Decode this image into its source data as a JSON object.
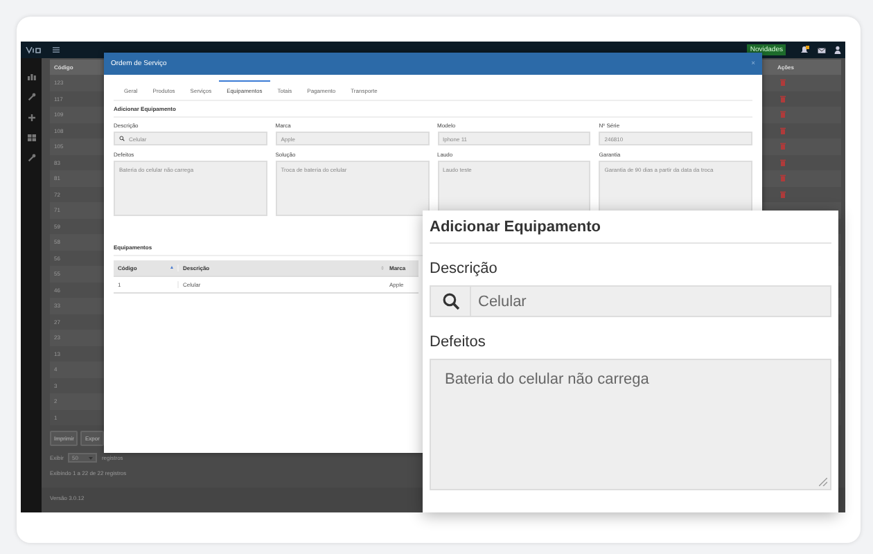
{
  "app": {
    "topbar": {
      "badge": "Novidades"
    },
    "list": {
      "columns": [
        "Código",
        "Ações"
      ],
      "rows": [
        {
          "code": "123",
          "kind": "deletable"
        },
        {
          "code": "117",
          "kind": "deletable"
        },
        {
          "code": "109",
          "kind": "deletable"
        },
        {
          "code": "108",
          "kind": "deletable"
        },
        {
          "code": "105",
          "kind": "deletable"
        },
        {
          "code": "83",
          "kind": "deletable"
        },
        {
          "code": "81",
          "kind": "deletable"
        },
        {
          "code": "72",
          "kind": "deletable"
        },
        {
          "code": "71",
          "kind": "plain"
        },
        {
          "code": "59",
          "kind": "plain"
        },
        {
          "code": "58",
          "kind": "plain"
        },
        {
          "code": "56",
          "kind": "plain"
        },
        {
          "code": "55",
          "kind": "plain"
        },
        {
          "code": "46",
          "kind": "plain"
        },
        {
          "code": "33",
          "kind": "plain"
        },
        {
          "code": "27",
          "kind": "plain"
        },
        {
          "code": "23",
          "kind": "plain"
        },
        {
          "code": "13",
          "kind": "plain"
        },
        {
          "code": "4",
          "kind": "plain"
        },
        {
          "code": "3",
          "kind": "plain"
        },
        {
          "code": "2",
          "kind": "plain"
        },
        {
          "code": "1",
          "kind": "plain"
        }
      ]
    },
    "buttons": [
      "Imprimir",
      "Expor"
    ],
    "page_length": {
      "prefix": "Exibir",
      "value": "50",
      "suffix": "registros"
    },
    "info": "Exibindo 1 a 22 de 22 registros",
    "footer": "Versão 3.0.12"
  },
  "modal": {
    "title": "Ordem de Serviço",
    "close": "×",
    "tabs": [
      {
        "label": "Geral",
        "selected": false
      },
      {
        "label": "Produtos",
        "selected": false
      },
      {
        "label": "Serviços",
        "selected": false
      },
      {
        "label": "Equipamentos",
        "selected": true
      },
      {
        "label": "Totais",
        "selected": false
      },
      {
        "label": "Pagamento",
        "selected": false
      },
      {
        "label": "Transporte",
        "selected": false
      }
    ],
    "section": "Adicionar Equipamento",
    "fields": [
      {
        "label": "Descrição",
        "value": "Celular",
        "kind": "search"
      },
      {
        "label": "Marca",
        "value": "Apple",
        "kind": "text"
      },
      {
        "label": "Modelo",
        "value": "Iphone 11",
        "kind": "text"
      },
      {
        "label": "Nº Série",
        "value": "246810",
        "kind": "text"
      }
    ],
    "textareas": [
      {
        "label": "Defeitos",
        "value": "Bateria do celular não carrega"
      },
      {
        "label": "Solução",
        "value": "Troca de bateria do celular"
      },
      {
        "label": "Laudo",
        "value": "Laudo teste"
      },
      {
        "label": "Garantia",
        "value": "Garantia de 90 dias a partir da data da troca"
      }
    ],
    "table": {
      "title": "Equipamentos",
      "columns": [
        "Código",
        "Descrição",
        "Marca"
      ],
      "rows": [
        [
          "1",
          "Celular",
          "Apple"
        ]
      ]
    }
  },
  "callout": {
    "section": "Adicionar Equipamento",
    "field_label": "Descrição",
    "field_value": "Celular",
    "textarea_label": "Defeitos",
    "textarea_value": "Bateria do celular não carrega"
  }
}
